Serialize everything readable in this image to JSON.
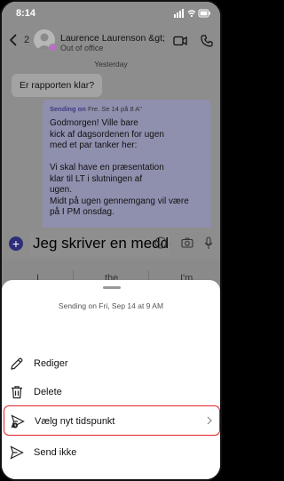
{
  "status_bar": {
    "time": "8:14"
  },
  "header": {
    "participant_count": "2",
    "contact_name": "Laurence Laurenson &gt;",
    "contact_status": "Out of office"
  },
  "chat": {
    "day_label": "Yesterday",
    "incoming_message": "Er rapporten klar?",
    "scheduled_prefix": "Sending on",
    "scheduled_time": "Fre. Se 14 på 8 A\"",
    "outgoing_lines": [
      "Godmorgen! Ville bare",
      "kick af dagsordenen for ugen",
      "med et par tanker her:",
      "",
      "Vi skal have en præsentation",
      "klar til LT i slutningen af",
      "ugen.",
      "Midt på ugen gennemgang vil være",
      "på I PM onsdag."
    ]
  },
  "composer": {
    "text": "Jeg skriver en meddelelse"
  },
  "keyboard": {
    "suggestions": [
      "I",
      "the",
      "I'm"
    ]
  },
  "sheet": {
    "title": "Sending on Fri, Sep 14 at 9 AM",
    "items": [
      {
        "label": "Rediger",
        "icon": "pencil-icon"
      },
      {
        "label": "Delete",
        "icon": "trash-icon"
      },
      {
        "label": "Vælg nyt tidspunkt",
        "icon": "send-clock-icon"
      },
      {
        "label": "Send ikke",
        "icon": "send-icon"
      }
    ]
  },
  "colors": {
    "accent": "#2e2d7a",
    "highlight_border": "#e0242b",
    "dim_overlay": "#8d8d8d"
  }
}
